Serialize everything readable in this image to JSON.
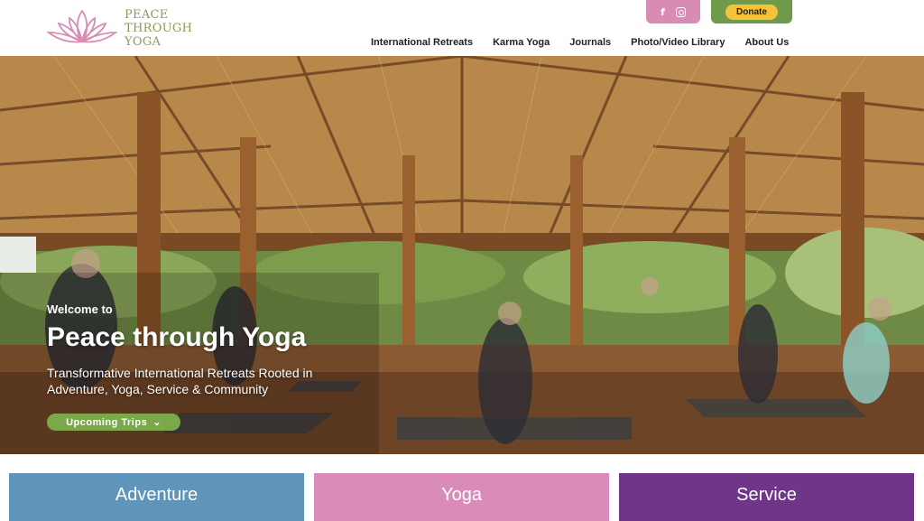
{
  "brand": {
    "name_lines": [
      "PEACE",
      "THROUGH",
      "YOGA"
    ],
    "logo_color": "#d98cb3",
    "text_color": "#8a9a5b"
  },
  "social": {
    "bar_color": "#d98cb3",
    "icons": [
      "facebook-icon",
      "instagram-icon"
    ]
  },
  "donate": {
    "label": "Donate",
    "button_color": "#f6c23a",
    "bar_color": "#6e9a4a"
  },
  "nav": {
    "items": [
      "International Retreats",
      "Karma Yoga",
      "Journals",
      "Photo/Video Library",
      "About Us"
    ]
  },
  "hero": {
    "welcome": "Welcome to",
    "title": "Peace through Yoga",
    "subtitle": "Transformative International Retreats Rooted in Adventure, Yoga, Service & Community",
    "cta_label": "Upcoming Trips",
    "cta_icon": "chevron-down-icon",
    "cta_color": "#7aa84a"
  },
  "pillars": [
    {
      "label": "Adventure",
      "color": "#5f95b8"
    },
    {
      "label": "Yoga",
      "color": "#d98cb8"
    },
    {
      "label": "Service",
      "color": "#6e3589"
    }
  ]
}
